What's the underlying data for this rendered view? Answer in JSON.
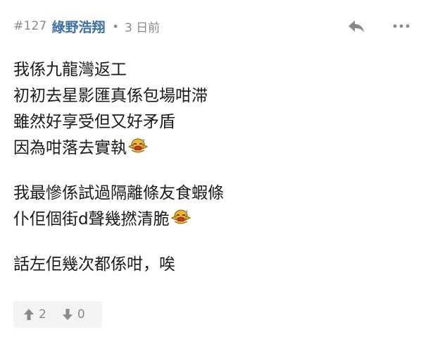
{
  "post": {
    "number": "#127",
    "author": "綠野浩翔",
    "separator": "•",
    "timestamp": "3 日前"
  },
  "actions": {
    "reply_icon": "reply-icon",
    "more_icon": "more-icon"
  },
  "content": {
    "paragraph_1": {
      "line_1": "我係九龍灣返工",
      "line_2": "初初去星影匯真係包場咁滞",
      "line_3": "雖然好享受但又好矛盾",
      "line_4": "因為咁落去實執"
    },
    "paragraph_2": {
      "line_1": "我最慘係試過隔離條友食蝦條",
      "line_2": "仆佢個街d聲幾撚清脆"
    },
    "paragraph_3": {
      "line_1": "話左佢幾次都係咁，唉"
    },
    "emoji_icon": "sweat-emoji-icon"
  },
  "votes": {
    "up_count": "2",
    "down_count": "0",
    "up_icon": "thumbs-up-arrow-icon",
    "down_icon": "thumbs-down-arrow-icon"
  },
  "colors": {
    "author": "#3b6fa5",
    "meta": "#8a8a8a",
    "text": "#1a1a1a",
    "vote_bg": "#f3f3f3",
    "emoji": "#f2b52c"
  }
}
